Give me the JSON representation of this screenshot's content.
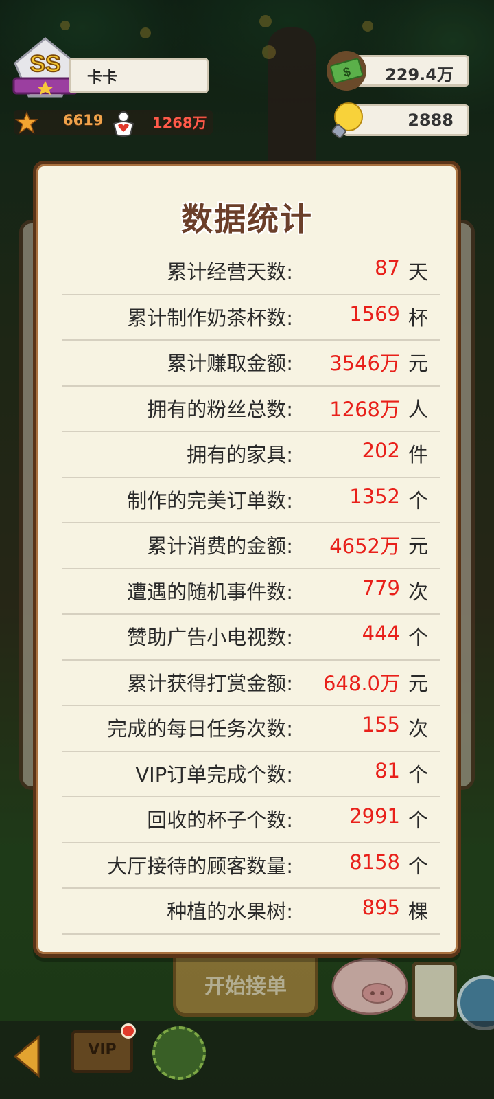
{
  "player": {
    "rank": "SS",
    "name": "卡卡",
    "stars": "6619",
    "fans": "1268万"
  },
  "currency": {
    "money": "229.4万",
    "ideas": "2888"
  },
  "modal": {
    "title": "数据统计",
    "rows": [
      {
        "label": "累计经营天数:",
        "value": "87",
        "unit": "天"
      },
      {
        "label": "累计制作奶茶杯数:",
        "value": "1569",
        "unit": "杯"
      },
      {
        "label": "累计赚取金额:",
        "value": "3546万",
        "unit": "元"
      },
      {
        "label": "拥有的粉丝总数:",
        "value": "1268万",
        "unit": "人"
      },
      {
        "label": "拥有的家具:",
        "value": "202",
        "unit": "件"
      },
      {
        "label": "制作的完美订单数:",
        "value": "1352",
        "unit": "个"
      },
      {
        "label": "累计消费的金额:",
        "value": "4652万",
        "unit": "元"
      },
      {
        "label": "遭遇的随机事件数:",
        "value": "779",
        "unit": "次"
      },
      {
        "label": "赞助广告小电视数:",
        "value": "444",
        "unit": "个"
      },
      {
        "label": "累计获得打赏金额:",
        "value": "648.0万",
        "unit": "元"
      },
      {
        "label": "完成的每日任务次数:",
        "value": "155",
        "unit": "次"
      },
      {
        "label": "VIP订单完成个数:",
        "value": "81",
        "unit": "个"
      },
      {
        "label": "回收的杯子个数:",
        "value": "2991",
        "unit": "个"
      },
      {
        "label": "大厅接待的顾客数量:",
        "value": "8158",
        "unit": "个"
      },
      {
        "label": "种植的水果树:",
        "value": "895",
        "unit": "棵"
      }
    ]
  },
  "bottom": {
    "start_label": "开始接单",
    "vip_label": "VIP"
  },
  "colors": {
    "value_red": "#e8201a",
    "title_brown": "#6b3f2a",
    "panel_bg": "#f7f3e2",
    "panel_border": "#5a3418"
  }
}
